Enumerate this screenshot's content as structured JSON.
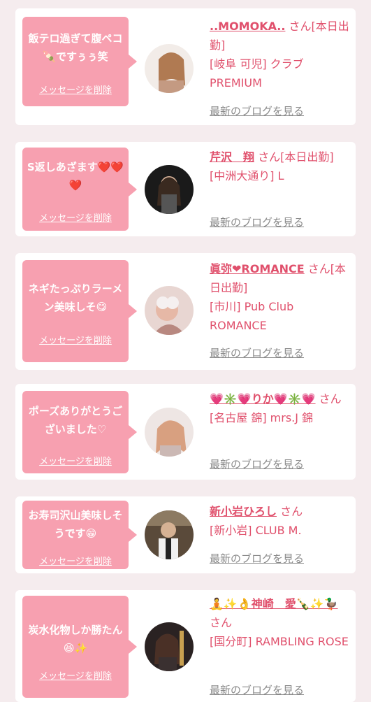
{
  "messages": [
    {
      "bubble_text": "飯テロ過ぎて腹ペコ🍡ですぅぅ笑",
      "delete_label": "メッセージを削除",
      "name": "..MOMOKA..",
      "suffix": "さん[本日出勤]",
      "shop": "[岐阜 可児] クラブPREMIUM",
      "blog_label": "最新のブログを見る",
      "avatar_color": "#c49a82"
    },
    {
      "bubble_text": "S返しあざます❤️❤️❤️",
      "delete_label": "メッセージを削除",
      "name": "芹沢　翔",
      "suffix": "さん[本日出勤]",
      "shop": "[中洲大通り] L",
      "blog_label": "最新のブログを見る",
      "avatar_color": "#2a2a2a"
    },
    {
      "bubble_text": "ネギたっぷりラーメン美味しそ😋",
      "delete_label": "メッセージを削除",
      "name": "眞弥❤ROMANCE",
      "suffix": "さん[本日出勤]",
      "shop": "[市川] Pub Club ROMANCE",
      "blog_label": "最新のブログを見る",
      "avatar_color": "#d9a6a4"
    },
    {
      "bubble_text": "ポーズありがとうございました♡",
      "delete_label": "メッセージを削除",
      "name": "💗✳️💗りか💗✳️💗",
      "suffix": "さん",
      "shop": "[名古屋 錦] mrs.J 錦",
      "blog_label": "最新のブログを見る",
      "avatar_color": "#d8c8c4"
    },
    {
      "bubble_text": "お寿司沢山美味しそうです😁",
      "delete_label": "メッセージを削除",
      "name": "新小岩ひろし",
      "suffix": "さん",
      "shop": "[新小岩] CLUB M.",
      "blog_label": "最新のブログを見る",
      "avatar_color": "#4a3f36"
    },
    {
      "bubble_text": "炭水化物しか勝たん😆✨",
      "delete_label": "メッセージを削除",
      "name": "🧘✨👌神崎　愛🍾✨🦆",
      "suffix": "さん",
      "shop": "[国分町] RAMBLING ROSE",
      "blog_label": "最新のブログを見る",
      "avatar_color": "#3a3030"
    }
  ],
  "colors": {
    "page_background": "#f5ecee",
    "card_background": "#ffffff",
    "bubble": "#f7a0b0",
    "name_pink": "#e0506c",
    "blog_link_gray": "#8a8a8a"
  }
}
